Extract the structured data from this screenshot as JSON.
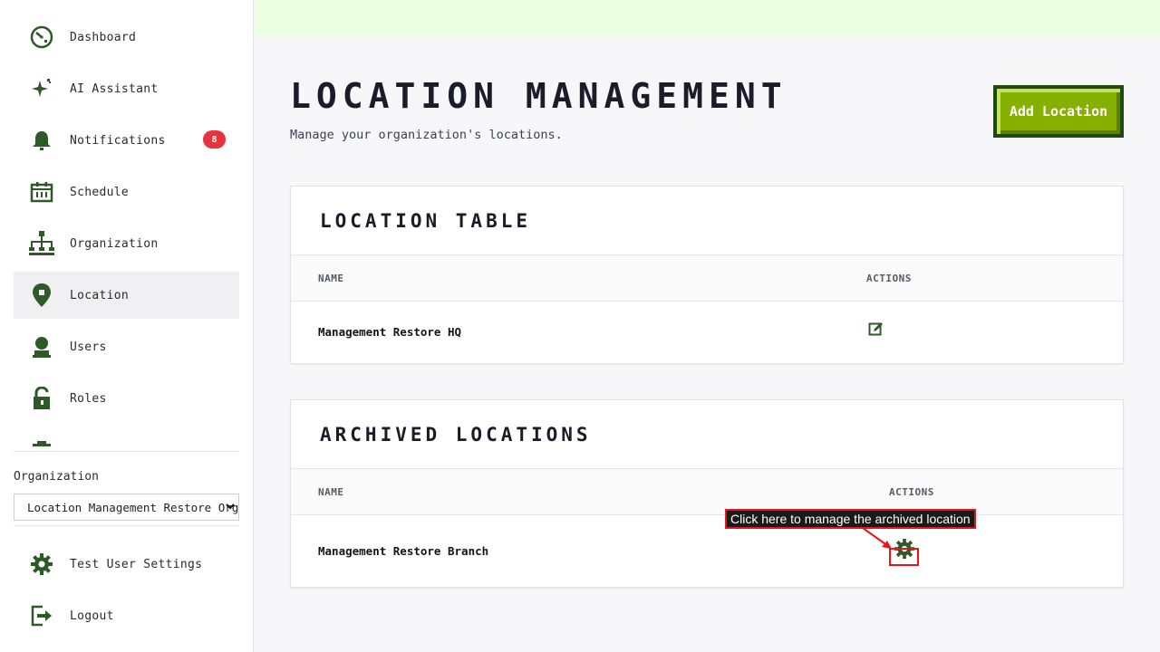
{
  "sidebar": {
    "items": [
      {
        "label": "Dashboard",
        "icon": "dashboard-icon"
      },
      {
        "label": "AI Assistant",
        "icon": "sparkle-icon"
      },
      {
        "label": "Notifications",
        "icon": "bell-icon",
        "badge": "8"
      },
      {
        "label": "Schedule",
        "icon": "calendar-icon"
      },
      {
        "label": "Organization",
        "icon": "org-chart-icon"
      },
      {
        "label": "Location",
        "icon": "location-pin-icon"
      },
      {
        "label": "Users",
        "icon": "user-icon"
      },
      {
        "label": "Roles",
        "icon": "lock-icon"
      }
    ],
    "org_label": "Organization",
    "org_selected": "Location Management Restore Org",
    "settings_label": "Test User Settings",
    "logout_label": "Logout"
  },
  "header": {
    "title": "LOCATION MANAGEMENT",
    "subtitle": "Manage your organization's locations.",
    "add_button": "Add Location"
  },
  "location_table": {
    "title": "LOCATION TABLE",
    "columns": [
      "NAME",
      "ACTIONS"
    ],
    "rows": [
      {
        "name": "Management Restore HQ",
        "action_icon": "edit-icon"
      }
    ]
  },
  "archived_table": {
    "title": "ARCHIVED LOCATIONS",
    "columns": [
      "NAME",
      "ACTIONS"
    ],
    "rows": [
      {
        "name": "Management Restore Branch",
        "action_icon": "gear-icon"
      }
    ]
  },
  "annotation": {
    "text": "Click here to manage the archived location"
  },
  "colors": {
    "accent_green": "#86b000",
    "icon_green": "#2e5a27",
    "badge_red": "#e8323d",
    "topbar": "#ebffe3"
  }
}
